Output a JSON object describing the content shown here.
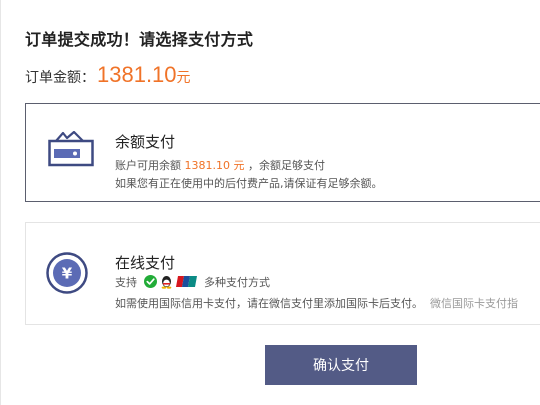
{
  "header": {
    "title": "订单提交成功！请选择支付方式"
  },
  "order": {
    "amount_label": "订单金额：",
    "amount_value": "1381.10",
    "amount_unit": "元"
  },
  "payment_methods": [
    {
      "title": "余额支付",
      "icon": "wallet-icon",
      "line1_prefix": "账户可用余额",
      "line1_amount": "1381.10 元",
      "line1_suffix": "，余额足够支付",
      "line2": "如果您有正在使用中的后付费产品,请保证有足够余额。",
      "selected": true
    },
    {
      "title": "在线支付",
      "icon": "yuan-coin-icon",
      "line1_prefix": "支持",
      "logos": [
        "wechat-pay-icon",
        "qq-pay-icon",
        "unionpay-icon"
      ],
      "line1_suffix": "多种支付方式",
      "line2": "如需使用国际信用卡支付，请在微信支付里添加国际卡后支付。",
      "line2_extra": "微信国际卡支付指",
      "selected": false
    }
  ],
  "actions": {
    "confirm_label": "确认支付"
  },
  "colors": {
    "accent_orange": "#f07328",
    "primary_button": "#535b86",
    "icon_blue": "#3e4a82"
  }
}
